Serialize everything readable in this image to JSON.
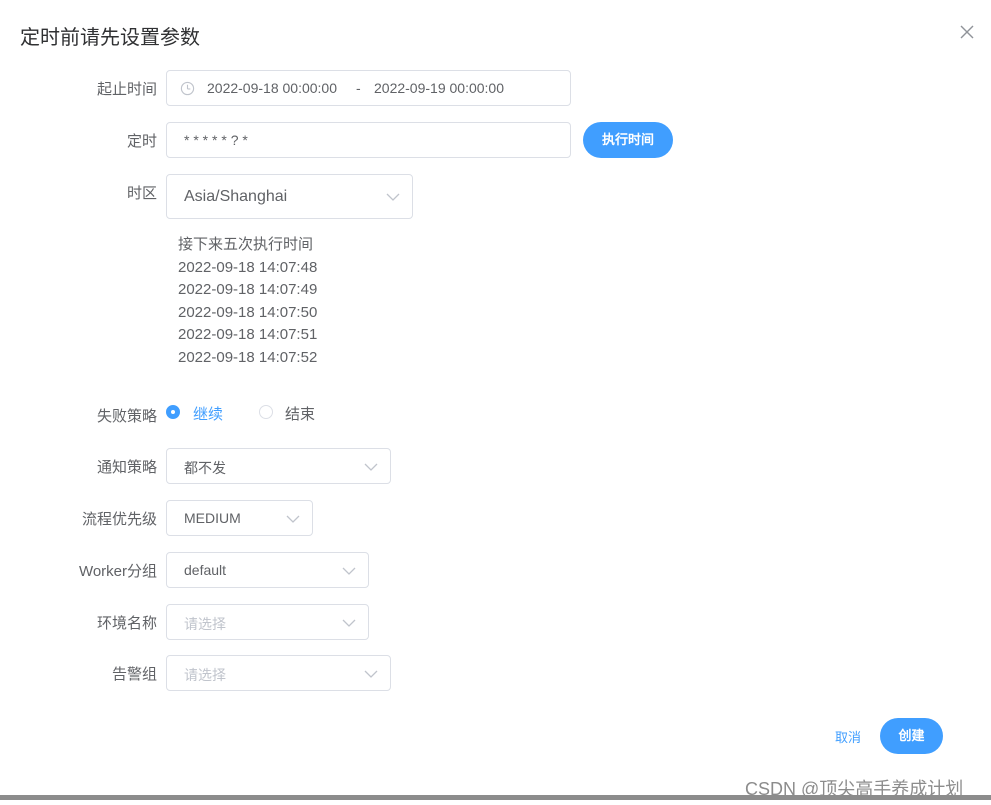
{
  "dialog": {
    "title": "定时前请先设置参数",
    "close_icon": "close-icon"
  },
  "fields": {
    "time_range": {
      "label": "起止时间",
      "start": "2022-09-18 00:00:00",
      "separator": "-",
      "end": "2022-09-19 00:00:00",
      "icon": "clock-icon"
    },
    "cron": {
      "label": "定时",
      "value": "* * * * * ? *",
      "button": "执行时间"
    },
    "timezone": {
      "label": "时区",
      "value": "Asia/Shanghai"
    },
    "next_runs": {
      "heading": "接下来五次执行时间",
      "times": [
        "2022-09-18 14:07:48",
        "2022-09-18 14:07:49",
        "2022-09-18 14:07:50",
        "2022-09-18 14:07:51",
        "2022-09-18 14:07:52"
      ]
    },
    "failure_strategy": {
      "label": "失败策略",
      "options": [
        "继续",
        "结束"
      ],
      "selected": "继续"
    },
    "notify_strategy": {
      "label": "通知策略",
      "value": "都不发"
    },
    "priority": {
      "label": "流程优先级",
      "value": "MEDIUM"
    },
    "worker_group": {
      "label": "Worker分组",
      "value": "default"
    },
    "environment": {
      "label": "环境名称",
      "placeholder": "请选择"
    },
    "alert_group": {
      "label": "告警组",
      "placeholder": "请选择"
    }
  },
  "footer": {
    "cancel": "取消",
    "create": "创建"
  },
  "watermark": "CSDN @顶尖高手养成计划",
  "colors": {
    "primary": "#409eff",
    "border": "#dcdfe6",
    "text": "#606266",
    "placeholder": "#c0c4cc"
  }
}
